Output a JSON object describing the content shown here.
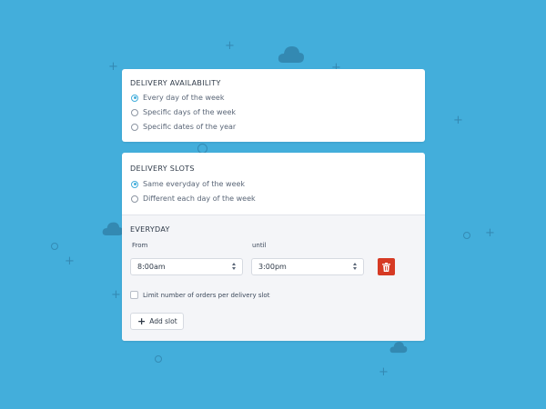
{
  "availability": {
    "title": "DELIVERY AVAILABILITY",
    "options": [
      {
        "label": "Every day of the week",
        "selected": true
      },
      {
        "label": "Specific days of the week",
        "selected": false
      },
      {
        "label": "Specific dates of the year",
        "selected": false
      }
    ]
  },
  "slots": {
    "title": "DELIVERY SLOTS",
    "options": [
      {
        "label": "Same everyday of the week",
        "selected": true
      },
      {
        "label": "Different each day of the week",
        "selected": false
      }
    ],
    "everyday": {
      "title": "EVERYDAY",
      "from_label": "From",
      "until_label": "until",
      "from_value": "8:00am",
      "until_value": "3:00pm",
      "limit_label": "Limit number of orders per delivery slot",
      "limit_checked": false,
      "add_slot_label": "Add slot"
    }
  },
  "colors": {
    "background": "#43aedb",
    "accent": "#43aedb",
    "danger": "#d63a24"
  }
}
